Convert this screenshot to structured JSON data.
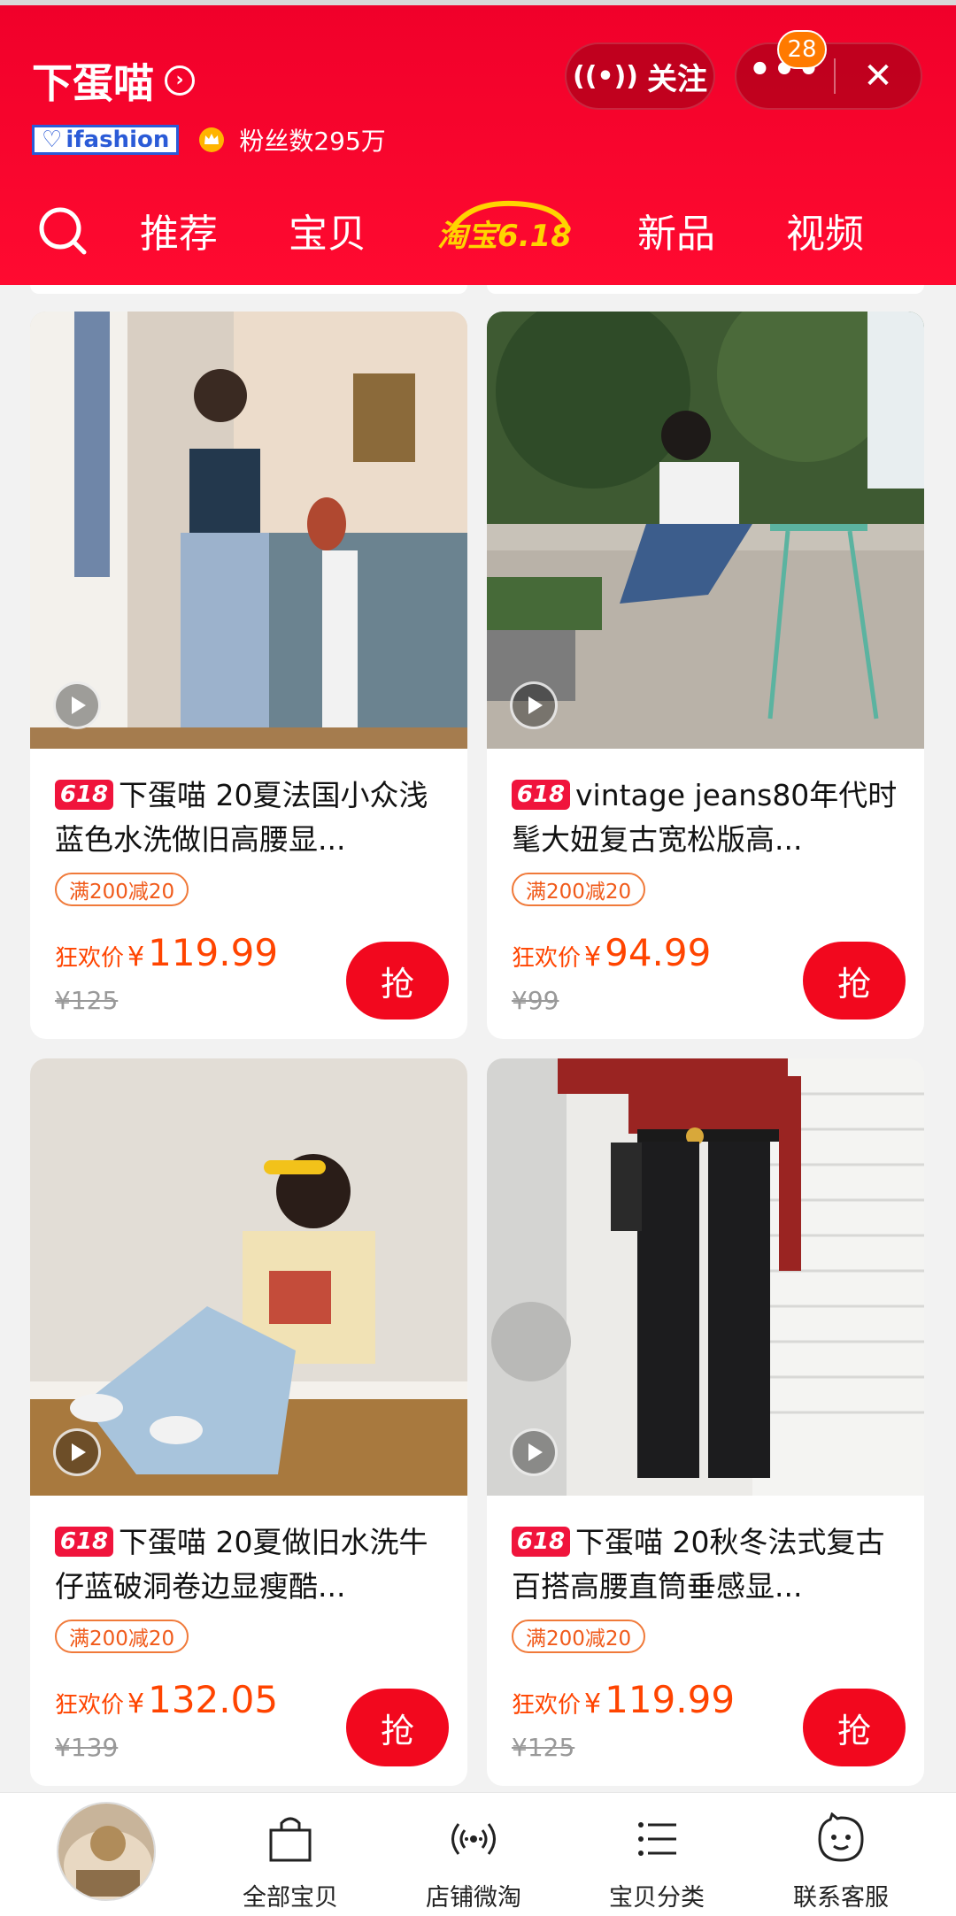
{
  "header": {
    "shop_name": "下蛋喵",
    "brand_badge": "ifashion",
    "fans": "粉丝数295万",
    "follow_label": "关注",
    "more_label": "•••",
    "close_label": "✕",
    "notification_count": "28"
  },
  "nav": {
    "tabs": [
      "推荐",
      "宝贝",
      "新品",
      "视频"
    ],
    "event_logo_text": "淘宝6.18"
  },
  "products": [
    {
      "tag": "618",
      "title": "下蛋喵 20夏法国小众浅蓝色水洗做旧高腰显...",
      "coupon": "满200减20",
      "price_label": "狂欢价",
      "currency": "¥",
      "price": "119.99",
      "original_price": "¥125",
      "grab_label": "抢"
    },
    {
      "tag": "618",
      "title": "vintage jeans80年代时髦大妞复古宽松版高...",
      "coupon": "满200减20",
      "price_label": "狂欢价",
      "currency": "¥",
      "price": "94.99",
      "original_price": "¥99",
      "grab_label": "抢"
    },
    {
      "tag": "618",
      "title": "下蛋喵 20夏做旧水洗牛仔蓝破洞卷边显瘦酷...",
      "coupon": "满200减20",
      "price_label": "狂欢价",
      "currency": "¥",
      "price": "132.05",
      "original_price": "¥139",
      "grab_label": "抢"
    },
    {
      "tag": "618",
      "title": "下蛋喵 20秋冬法式复古百搭高腰直筒垂感显...",
      "coupon": "满200减20",
      "price_label": "狂欢价",
      "currency": "¥",
      "price": "119.99",
      "original_price": "¥125",
      "grab_label": "抢"
    }
  ],
  "bottom_bar": {
    "items": [
      {
        "label": "全部宝贝",
        "icon": "shopping-bag-icon"
      },
      {
        "label": "店铺微淘",
        "icon": "broadcast-icon"
      },
      {
        "label": "宝贝分类",
        "icon": "list-icon"
      },
      {
        "label": "联系客服",
        "icon": "chat-bubble-icon"
      }
    ]
  },
  "colors": {
    "brand_red": "#ff0a30",
    "price_orange": "#ff4400",
    "badge_orange": "#ff7a00"
  }
}
